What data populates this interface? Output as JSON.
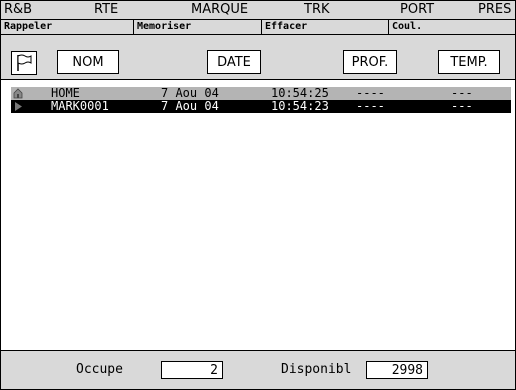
{
  "menu": {
    "items": [
      "R&B",
      "RTE",
      "MARQUE",
      "TRK",
      "PORT",
      "PRES"
    ]
  },
  "fkeys": {
    "items": [
      "Rappeler",
      "Memoriser",
      "Effacer",
      "Coul."
    ]
  },
  "columns": {
    "nom": "NOM",
    "date": "DATE",
    "prof": "PROF.",
    "temp": "TEMP."
  },
  "rows": [
    {
      "icon": "home-icon",
      "name": "HOME",
      "date": "7 Aou 04",
      "time": "10:54:25",
      "prof": "----",
      "temp": "---"
    },
    {
      "icon": "play-arrow-icon",
      "name": "MARK0001",
      "date": "7 Aou 04",
      "time": "10:54:23",
      "prof": "----",
      "temp": "---"
    }
  ],
  "status": {
    "occupe_label": "Occupe",
    "occupe_value": "2",
    "dispo_label": "Disponibl",
    "dispo_value": "2998"
  }
}
